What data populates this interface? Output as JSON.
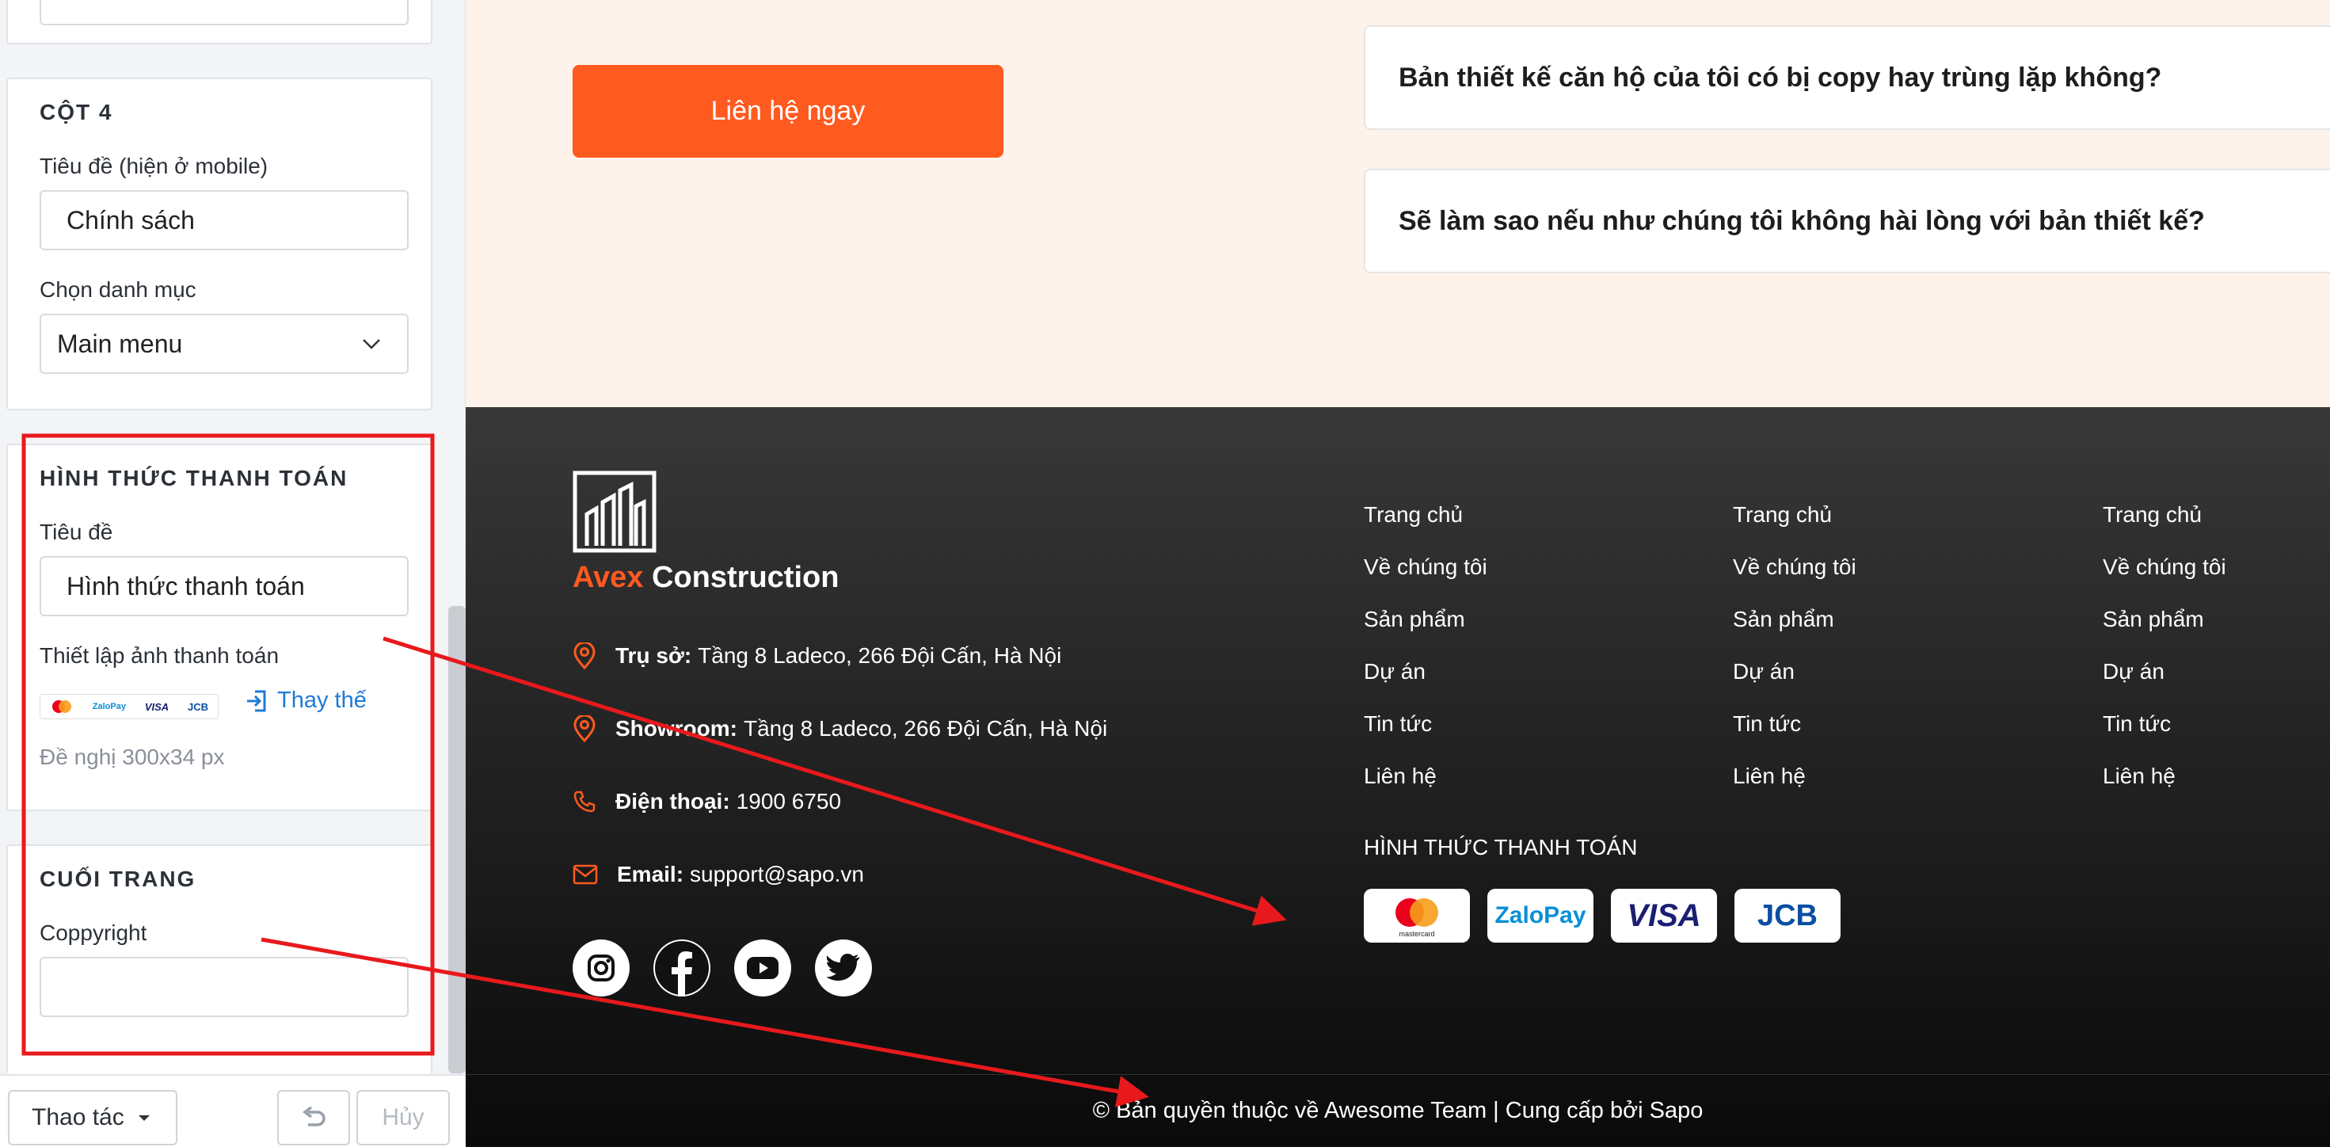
{
  "sidebar": {
    "col4": {
      "title": "CỘT 4",
      "title_label": "Tiêu đề (hiện ở mobile)",
      "title_value": "Chính sách",
      "menu_label": "Chọn danh mục",
      "menu_value": "Main menu"
    },
    "payment": {
      "title": "HÌNH THỨC THANH TOÁN",
      "title_label": "Tiêu đề",
      "title_value": "Hình thức thanh toán",
      "image_label": "Thiết lập ảnh thanh toán",
      "replace_label": "Thay thế",
      "hint": "Đề nghị 300x34 px"
    },
    "bottom": {
      "title": "CUỐI TRANG",
      "copyright_label": "Coppyright",
      "copyright_value": ""
    },
    "actions": {
      "thao_tac": "Thao tác",
      "huy": "Hủy"
    }
  },
  "preview": {
    "cta": "Liên hệ ngay",
    "faqs": [
      "Bản thiết kế căn hộ của tôi có bị copy hay trùng lặp không?",
      "Sẽ làm sao nếu như chúng tôi không hài lòng với bản thiết kế?"
    ],
    "brand": {
      "part1": "Avex",
      "part2": " Construction"
    },
    "info": {
      "office_label": "Trụ sở:",
      "office": "Tầng 8 Ladeco, 266 Đội Cấn, Hà Nội",
      "showroom_label": "Showroom:",
      "showroom": "Tầng 8 Ladeco, 266 Đội Cấn, Hà Nội",
      "phone_label": "Điện thoại:",
      "phone": "1900 6750",
      "email_label": "Email:",
      "email": "support@sapo.vn"
    },
    "menu": [
      "Trang chủ",
      "Về chúng tôi",
      "Sản phẩm",
      "Dự án",
      "Tin tức",
      "Liên hệ"
    ],
    "payment_title": "HÌNH THỨC THANH TOÁN",
    "payment_methods": [
      "mastercard",
      "ZaloPay",
      "VISA",
      "JCB"
    ],
    "copyright": "© Bản quyền thuộc về Awesome Team | Cung cấp bởi Sapo"
  },
  "colors": {
    "accent": "#ff5a1f",
    "annotation": "#e8191c",
    "link": "#1f7ad8"
  }
}
